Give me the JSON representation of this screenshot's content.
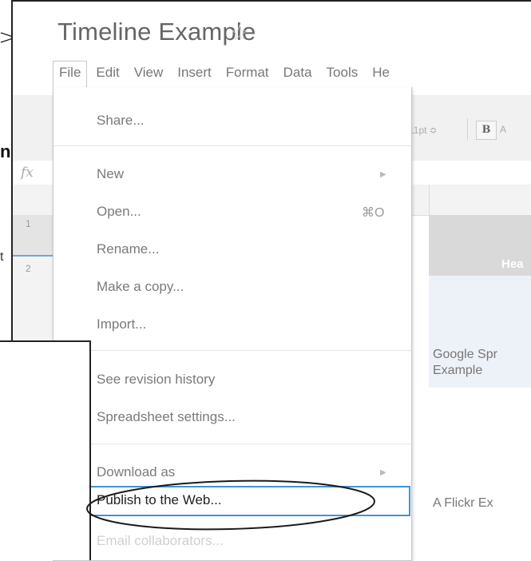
{
  "document": {
    "title": "Timeline Example",
    "star_icon": "star-outline-icon"
  },
  "menubar": {
    "items": [
      "File",
      "Edit",
      "View",
      "Insert",
      "Format",
      "Data",
      "Tools",
      "He"
    ]
  },
  "toolbar": {
    "font_size": "11pt ≎",
    "bold_label": "B",
    "next_partial": "A"
  },
  "formula_bar": {
    "fx_label": "fx"
  },
  "grid": {
    "row_numbers": [
      "1",
      "2"
    ],
    "header_cell": "Hea",
    "cell_google": [
      "Google Spr",
      "Example"
    ],
    "cell_flickr": "A Flickr Ex"
  },
  "file_menu": {
    "share": "Share...",
    "new": "New",
    "open": "Open...",
    "open_shortcut": "⌘O",
    "rename": "Rename...",
    "make_copy": "Make a copy...",
    "import": "Import...",
    "revision_history": "See revision history",
    "spreadsheet_settings": "Spreadsheet settings...",
    "download_as": "Download as",
    "publish": "Publish to the Web...",
    "email_collaborators": "Email collaborators..."
  },
  "left_strip": {
    "char_n": "n",
    "char_t": "t"
  },
  "colors": {
    "highlight_border": "#3f93d4",
    "row_selection": "#6fa8dc"
  }
}
